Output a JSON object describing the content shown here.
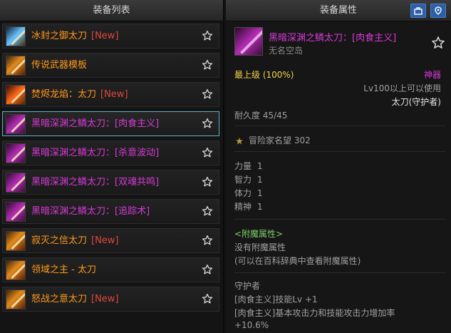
{
  "left_panel": {
    "title": "装备列表",
    "items": [
      {
        "name": "冰封之御太刀",
        "new": "[New]",
        "rarity": "orange",
        "icon": "ice-sword-icon",
        "selected": false
      },
      {
        "name": "传说武器模板",
        "new": "",
        "rarity": "orange",
        "icon": "legend-sword-icon",
        "selected": false
      },
      {
        "name": "焚烬龙焰：太刀",
        "new": "[New]",
        "rarity": "orange",
        "icon": "fire-sword-icon",
        "selected": false
      },
      {
        "name": "黑暗深渊之鳞太刀：[肉食主义]",
        "new": "",
        "rarity": "purple",
        "icon": "abyss-sword-icon",
        "selected": true
      },
      {
        "name": "黑暗深渊之鳞太刀：[杀意波动]",
        "new": "",
        "rarity": "purple",
        "icon": "abyss-sword-icon",
        "selected": false
      },
      {
        "name": "黑暗深渊之鳞太刀：[双魂共鸣]",
        "new": "",
        "rarity": "purple",
        "icon": "abyss-sword-icon",
        "selected": false
      },
      {
        "name": "黑暗深渊之鳞太刀：[追踪术]",
        "new": "",
        "rarity": "purple",
        "icon": "abyss-sword-icon",
        "selected": false
      },
      {
        "name": "寂灭之信太刀",
        "new": "[New]",
        "rarity": "orange",
        "icon": "legend-sword-icon",
        "selected": false
      },
      {
        "name": "领域之主 - 太刀",
        "new": "",
        "rarity": "orange",
        "icon": "legend-sword-icon",
        "selected": false
      },
      {
        "name": "怒战之意太刀",
        "new": "[New]",
        "rarity": "orange",
        "icon": "legend-sword-icon",
        "selected": false
      }
    ]
  },
  "right_panel": {
    "title": "装备属性",
    "item_name": "黑暗深渊之鳞太刀：[肉食主义]",
    "item_sub": "无名空岛",
    "grade": "最上级 (100%)",
    "rarity_label": "神器",
    "level_req": "Lv100以上可以使用",
    "weapon_type": "太刀(守护者)",
    "durability": "耐久度 45/45",
    "fame": "冒险家名望 302",
    "stats": [
      {
        "label": "力量",
        "value": "1"
      },
      {
        "label": "智力",
        "value": "1"
      },
      {
        "label": "体力",
        "value": "1"
      },
      {
        "label": "精神",
        "value": "1"
      }
    ],
    "enchant_header": "<附魔属性>",
    "enchant_none": "没有附魔属性",
    "enchant_hint": "(可以在百科辞典中查看附魔属性)",
    "set_title": "守护者",
    "set_lines": [
      "[肉食主义]技能Lv +1",
      "[肉食主义]基本攻击力和技能攻击力增加率",
      "+10.6%"
    ]
  },
  "colors": {
    "legendary": "#ff9a1c",
    "mythic": "#d63ad6",
    "new_tag": "#e0473f",
    "selection_border": "#5fb1c6",
    "grade": "#f0d24a",
    "enchant": "#7ccf6a"
  }
}
